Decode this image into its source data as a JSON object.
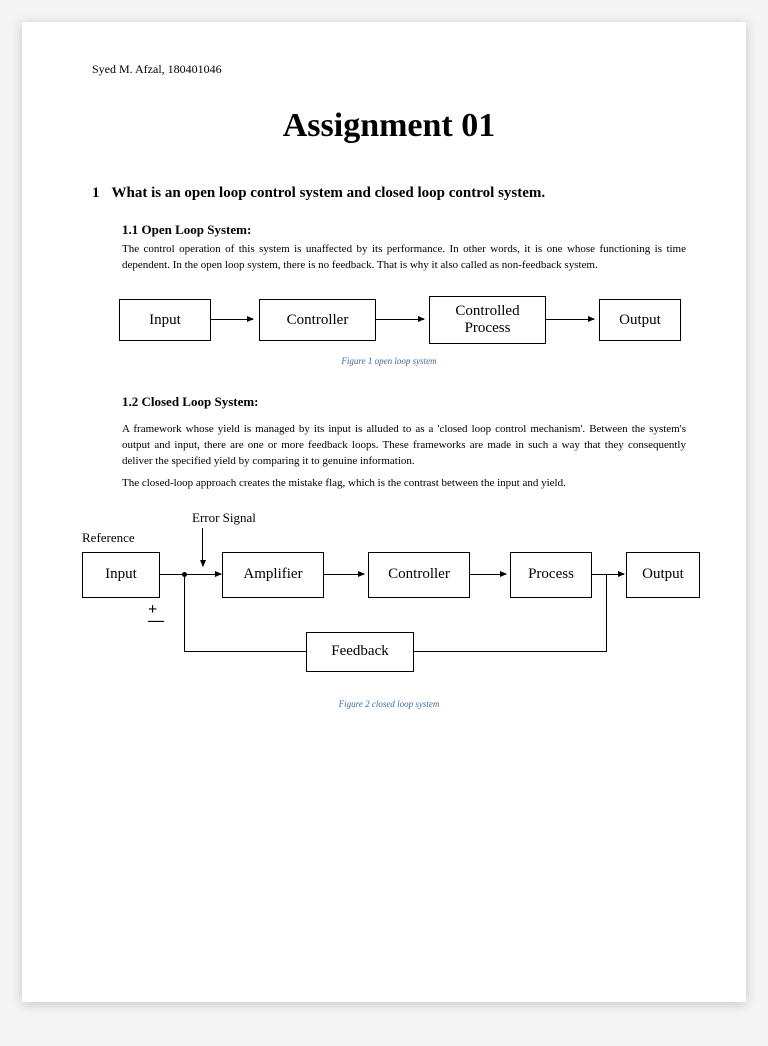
{
  "author": "Syed M. Afzal, 180401046",
  "title": "Assignment 01",
  "question": {
    "num": "1",
    "text": "What is an open loop control system and closed loop control system."
  },
  "section1": {
    "head": "1.1  Open Loop System:",
    "body": "The control operation of this system is unaffected by its performance. In other words, it is one whose functioning is time dependent. In the open loop system, there is no feedback. That is why it also called as non-feedback system."
  },
  "fig1": {
    "boxes": {
      "input": "Input",
      "ctrl": "Controller",
      "proc": "Controlled\nProcess",
      "out": "Output"
    },
    "caption": "Figure 1 open loop system"
  },
  "section2": {
    "head": "1.2 Closed Loop System:",
    "body1": "A framework whose yield is managed by its input is alluded to as a 'closed loop control mechanism'. Between the system's output and input, there are one or more feedback loops. These frameworks are made in such a way that they consequently deliver the specified yield by comparing it to genuine information.",
    "body2": "The closed-loop approach creates the mistake flag, which is the contrast between the input and yield."
  },
  "fig2": {
    "labels": {
      "ref": "Reference",
      "err": "Error Signal",
      "plus": "+",
      "minus": "—"
    },
    "boxes": {
      "input": "Input",
      "amp": "Amplifier",
      "ctrl": "Controller",
      "proc": "Process",
      "out": "Output",
      "fb": "Feedback"
    },
    "caption": "Figure 2 closed loop system"
  }
}
